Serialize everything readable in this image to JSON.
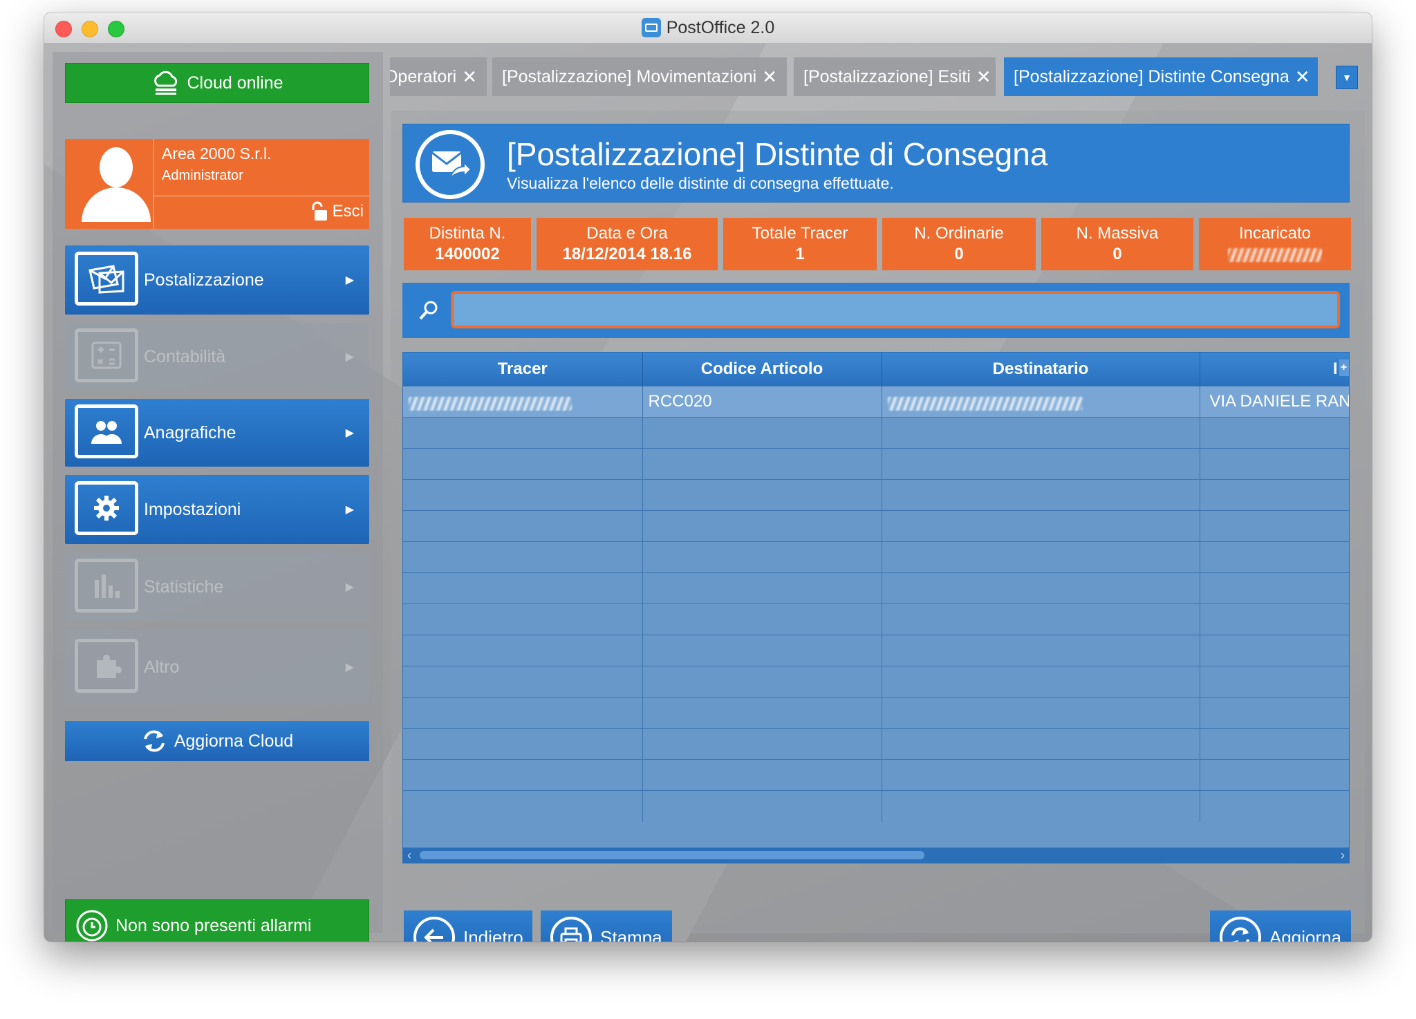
{
  "window": {
    "title": "PostOffice 2.0"
  },
  "sidebar": {
    "cloud_status": "Cloud online",
    "user": {
      "company": "Area 2000 S.r.l.",
      "role": "Administrator",
      "logout": "Esci"
    },
    "items": [
      {
        "label": "Postalizzazione",
        "enabled": true,
        "icon": "envelopes-icon"
      },
      {
        "label": "Contabilità",
        "enabled": false,
        "icon": "calculator-icon"
      },
      {
        "label": "Anagrafiche",
        "enabled": true,
        "icon": "people-icon"
      },
      {
        "label": "Impostazioni",
        "enabled": true,
        "icon": "gear-icon"
      },
      {
        "label": "Statistiche",
        "enabled": false,
        "icon": "bar-chart-icon"
      },
      {
        "label": "Altro",
        "enabled": false,
        "icon": "puzzle-icon"
      }
    ],
    "refresh_cloud": "Aggiorna Cloud",
    "alarms": "Non sono presenti allarmi"
  },
  "tabs": [
    {
      "label": "Operatori",
      "active": false
    },
    {
      "label": "[Postalizzazione] Movimentazioni",
      "active": false
    },
    {
      "label": "[Postalizzazione] Esiti",
      "active": false
    },
    {
      "label": "[Postalizzazione] Distinte Consegna",
      "active": true
    }
  ],
  "header": {
    "title": "[Postalizzazione] Distinte di Consegna",
    "subtitle": "Visualizza l'elenco delle distinte di consegna effettuate."
  },
  "stats": [
    {
      "label": "Distinta N.",
      "value": "1400002"
    },
    {
      "label": "Data e Ora",
      "value": "18/12/2014 18.16"
    },
    {
      "label": "Totale Tracer",
      "value": "1"
    },
    {
      "label": "N. Ordinarie",
      "value": "0"
    },
    {
      "label": "N. Massiva",
      "value": "0"
    },
    {
      "label": "Incaricato",
      "value": ""
    }
  ],
  "search": {
    "value": "",
    "placeholder": ""
  },
  "table": {
    "columns": [
      "Tracer",
      "Codice Articolo",
      "Destinatario",
      "I"
    ],
    "rows": [
      {
        "tracer": "",
        "codice": "RCC020",
        "destinatario": "",
        "indirizzo": "VIA DANIELE RAN"
      }
    ],
    "empty_rows": 13
  },
  "actions": {
    "back": "Indietro",
    "print": "Stampa",
    "refresh": "Aggiorna"
  },
  "colors": {
    "orange": "#ee6c2e",
    "blue": "#2f7fd0",
    "green": "#1e9e2c"
  }
}
